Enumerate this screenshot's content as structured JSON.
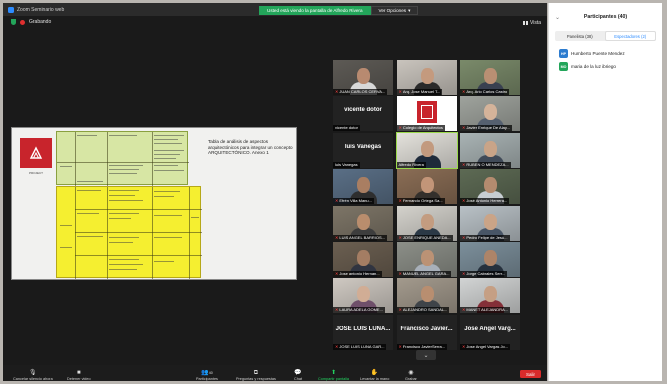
{
  "window": {
    "title": "Zoom Seminario web"
  },
  "share_banner": {
    "message": "Usted está viendo la pantalla de Alfredo Rivera",
    "options_label": "Ver Opciones"
  },
  "recording": {
    "label": "Grabando"
  },
  "view": {
    "label": "Vista"
  },
  "shared_slide": {
    "logo_text": "PROJECT",
    "caption": "Tabla de análisis de aspectos arquitectónicos para integrar un concepto ARQUITECTÓNICO. Anexo 1"
  },
  "video_tiles": [
    {
      "name": "JUAN CARLOS CERVA...",
      "muted": true,
      "skin": "#b88a70",
      "bg": "#5d5a55",
      "shirt": "#d8d8d8"
    },
    {
      "name": "Arq. Jose Manuel T...",
      "muted": true,
      "skin": "#c49a7e",
      "bg": "#c9c4bd",
      "shirt": "#2a2a2a"
    },
    {
      "name": "Arq. Ario Carlos Castro",
      "muted": true,
      "skin": "#b98f73",
      "bg": "#7a8a6a",
      "shirt": "#394050"
    },
    {
      "name": "vicente dotor",
      "muted": false,
      "name_only": true,
      "big": "vicente dotor"
    },
    {
      "name": "Colegio de Arquitectos",
      "muted": true,
      "logo": true,
      "bg": "#ffffff"
    },
    {
      "name": "Javier Enrique De Alay...",
      "muted": true,
      "skin": "#d4b39a",
      "bg": "#9fa39d",
      "shirt": "#556070"
    },
    {
      "name": "luis Vanegas",
      "muted": false,
      "name_only": true,
      "big": "luis Vanegas"
    },
    {
      "name": "Alfredo Rivera",
      "muted": false,
      "skin": "#c29a7f",
      "bg": "#e4e2dc",
      "shirt": "#1e2a3a",
      "active": true
    },
    {
      "name": "RUBEN O MENDEZA...",
      "muted": true,
      "skin": "#c9a488",
      "bg": "#a9b3b4",
      "shirt": "#404a58"
    },
    {
      "name": "Efrén Villa Manu...",
      "muted": true,
      "skin": "#a97e62",
      "bg": "#5a6f86",
      "shirt": "#2e2e2e"
    },
    {
      "name": "Fernando Ortega Sa...",
      "muted": true,
      "skin": "#c29578",
      "bg": "#8a6d55",
      "shirt": "#34302c"
    },
    {
      "name": "José Antonio Herrera...",
      "muted": true,
      "skin": "#b48b6f",
      "bg": "#5d6a54",
      "shirt": "#c7cdd2"
    },
    {
      "name": "LUIS ANGEL BARRIOS...",
      "muted": true,
      "skin": "#b98d6d",
      "bg": "#7d7567",
      "shirt": "#3d3d3d"
    },
    {
      "name": "JOSE ENRIQUE ANEDA...",
      "muted": true,
      "skin": "#c39c80",
      "bg": "#d4d2cc",
      "shirt": "#2b3946"
    },
    {
      "name": "Pedro Felipe de Jesú...",
      "muted": true,
      "skin": "#caa487",
      "bg": "#b9c1c6",
      "shirt": "#485566"
    },
    {
      "name": "Jose antonio Hernan...",
      "muted": true,
      "skin": "#a47d63",
      "bg": "#6b5f51",
      "shirt": "#303440"
    },
    {
      "name": "MANUEL ANGEL GARA...",
      "muted": true,
      "skin": "#bb9275",
      "bg": "#8c8f88",
      "shirt": "#a8b0ba"
    },
    {
      "name": "Jorge Cabrales Serr...",
      "muted": true,
      "skin": "#ad8468",
      "bg": "#7c8f9b",
      "shirt": "#26313d"
    },
    {
      "name": "LAURA ADELA GOME...",
      "muted": true,
      "skin": "#d1ad95",
      "bg": "#cfc9c2",
      "shirt": "#6f4f6a"
    },
    {
      "name": "ALEJANDRO SANDAL...",
      "muted": true,
      "skin": "#b88e70",
      "bg": "#a39a8d",
      "shirt": "#3f4449"
    },
    {
      "name": "MANET ALEJANDRA...",
      "muted": true,
      "skin": "#c59f84",
      "bg": "#d2d4d4",
      "shirt": "#842f38"
    },
    {
      "name": "JOSE LUIS LUNA GAR...",
      "muted": true,
      "name_only": true,
      "big": "JOSE LUIS LUNA..."
    },
    {
      "name": "Francisco JavierSerra...",
      "muted": true,
      "name_only": true,
      "big": "Francisco Javier..."
    },
    {
      "name": "Jose Angel Vargas Jo...",
      "muted": true,
      "name_only": true,
      "big": "Jose Angel Varg..."
    }
  ],
  "toolbar": {
    "mute": "Cancelar silencio ahora",
    "video": "Detener video",
    "participants": "Participantes",
    "participants_count": "40",
    "qa": "Preguntas y respuestas",
    "chat": "Chat",
    "share": "Compartir pantalla",
    "raise_hand": "Levantar la mano",
    "record": "Grabar",
    "leave": "Salir"
  },
  "panel": {
    "title": "Participantes (40)",
    "tabs": [
      {
        "label": "Panelista (38)",
        "active": false
      },
      {
        "label": "Espectadores (2)",
        "active": true
      }
    ],
    "attendees": [
      {
        "initials": "HP",
        "name": "Humberto Puente Mendez",
        "color": "#2d7ccf"
      },
      {
        "initials": "MO",
        "name": "maria de la luz ibriego",
        "color": "#23a55a"
      }
    ]
  },
  "colors": {
    "accent": "#2d8cff",
    "green": "#23a55a",
    "leave": "#d92b2b"
  }
}
